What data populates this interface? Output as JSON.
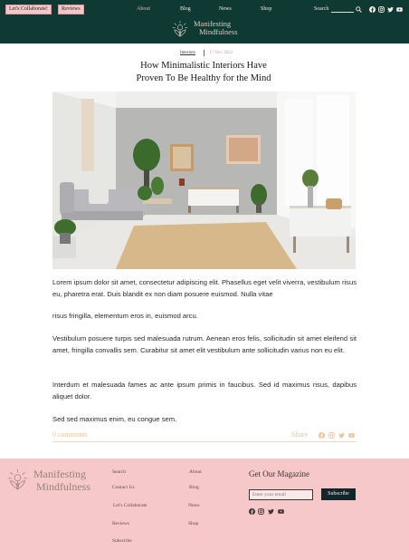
{
  "header": {
    "collab_label": "Let's Collaborate!",
    "reviews_label": "Reviews",
    "nav": [
      "About",
      "Blog",
      "News",
      "Shop"
    ],
    "search_label": "Search",
    "logo_line1": "Manifesting",
    "logo_line2": "Mindfulness",
    "social_icons": [
      "facebook-icon",
      "instagram-icon",
      "twitter-icon",
      "youtube-icon"
    ]
  },
  "article": {
    "category": "Interiors",
    "date": "17 Nov 2022",
    "title_line1": "How Minimalistic Interiors Have",
    "title_line2": "Proven To Be Healthy for the Mind",
    "paragraph1": "Lorem ipsum dolor sit amet, consectetur adipiscing elit. Phasellus eget velit viverra, vestibulum risus eu, pharetra erat. Duis blandit ex non diam posuere euismod. Nulla vitae",
    "paragraph1b": "risus fringilla, elementum eros in, euismod arcu.",
    "paragraph2": "Vestibulum posuere turpis sed malesuada rutrum. Aenean eros felis, sollicitudin sit amet eleifend sit amet, fringilla convallis sem. Curabitur sit amet elit vestibulum ante sollicitudin varius non eu elit.",
    "paragraph3": "Interdum et malesuada fames ac ante ipsum primis in faucibus. Sed id maximus risus, dapibus aliquet dolor.",
    "paragraph4": "Sed sed maximus enim, eu congue sem.",
    "comments": "0 comments",
    "share": "Share"
  },
  "footer": {
    "logo_line1": "Manifesting",
    "logo_line2": "Mindfulness",
    "links_col1": [
      "Search",
      "Contact Us",
      "Let's Collaborate",
      "Reviews",
      "Subscribe"
    ],
    "links_col2": [
      "About",
      "Blog",
      "News",
      "Shop"
    ],
    "magazine_title": "Get Our Magazine",
    "email_placeholder": "Enter your email",
    "subscribe_label": "Subscribe"
  },
  "colors": {
    "header_bg": "#0f3a33",
    "accent_pink": "#f7c8ca",
    "active_nav": "#f4a9ae",
    "share_tan": "#ecc39a"
  }
}
